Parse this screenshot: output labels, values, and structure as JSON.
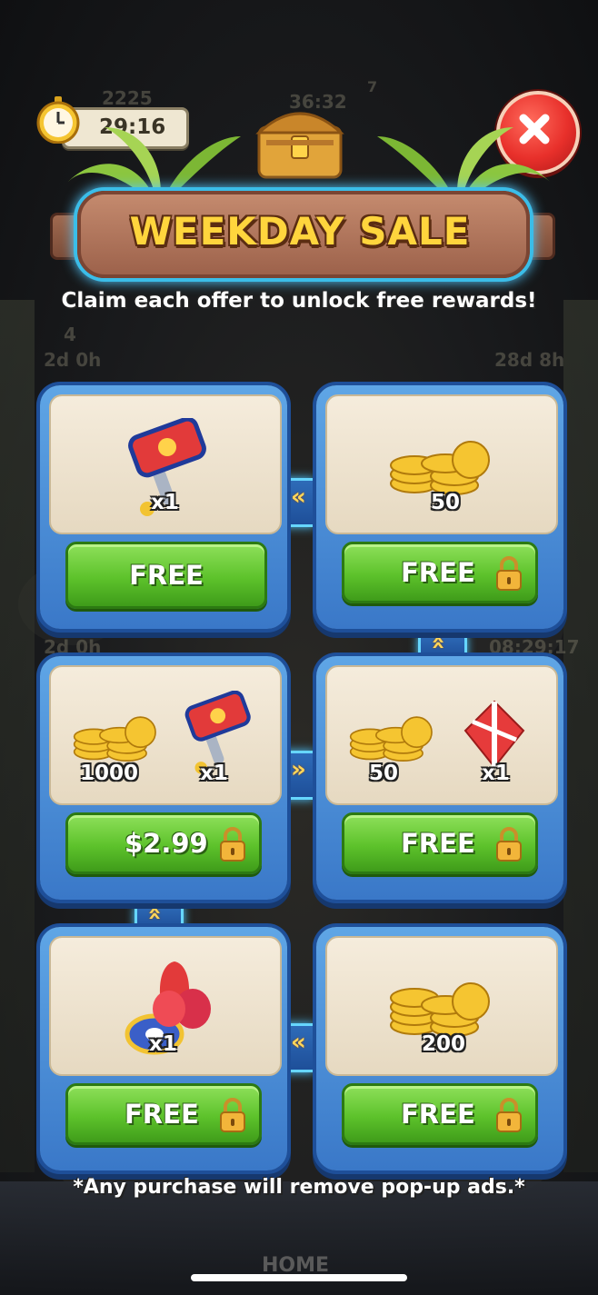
{
  "timer": {
    "value": "29:16"
  },
  "banner": {
    "title": "WEEKDAY SALE"
  },
  "subtitle": "Claim each offer to unlock free rewards!",
  "background_hud": {
    "coins": "2225",
    "lives_timer": "36:32",
    "badge": "7",
    "left_event": {
      "count": "4",
      "time": "2d 0h"
    },
    "right_event": {
      "time": "28d 8h"
    },
    "left_event2": {
      "time": "2d 0h"
    },
    "right_event2": {
      "time": "08:29:17"
    },
    "nav_home": "HOME"
  },
  "offers": [
    {
      "items": [
        {
          "icon": "hammer-icon",
          "qty": "x1"
        }
      ],
      "button": "FREE",
      "locked": false
    },
    {
      "items": [
        {
          "icon": "coins-icon",
          "qty": "50"
        }
      ],
      "button": "FREE",
      "locked": true
    },
    {
      "items": [
        {
          "icon": "coins-icon",
          "qty": "1000"
        },
        {
          "icon": "hammer-icon",
          "qty": "x1"
        }
      ],
      "button": "$2.99",
      "locked": true
    },
    {
      "items": [
        {
          "icon": "coins-icon",
          "qty": "50"
        },
        {
          "icon": "firework-icon",
          "qty": "x1"
        }
      ],
      "button": "FREE",
      "locked": true
    },
    {
      "items": [
        {
          "icon": "spinning-top-icon",
          "qty": "x1"
        }
      ],
      "button": "FREE",
      "locked": true
    },
    {
      "items": [
        {
          "icon": "coins-icon",
          "qty": "200"
        }
      ],
      "button": "FREE",
      "locked": true
    }
  ],
  "footer_note": "*Any purchase will remove pop-up ads.*",
  "colors": {
    "accent_green": "#5dc22b",
    "card_blue": "#3a78c8",
    "title_yellow": "#ffd53d",
    "close_red": "#e8302b"
  }
}
